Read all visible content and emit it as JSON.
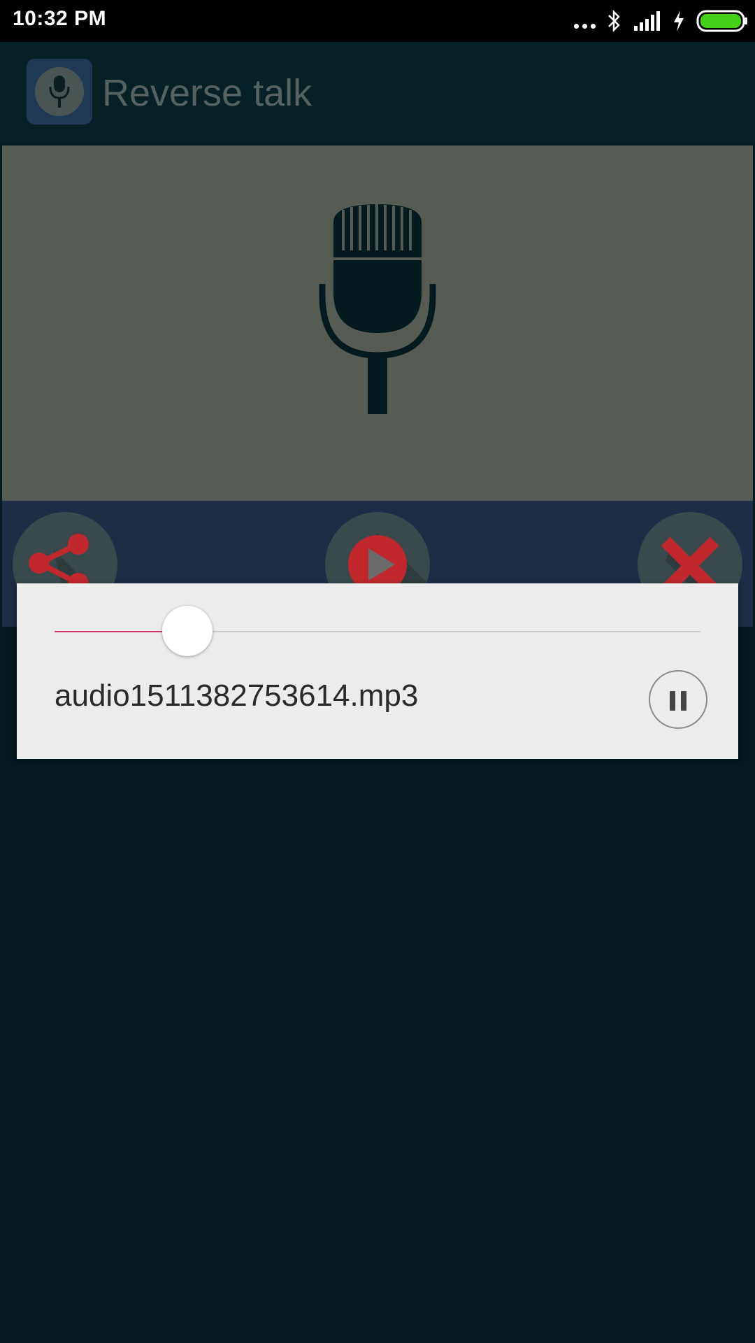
{
  "status_bar": {
    "time": "10:32 PM",
    "icons": [
      "more-dots-icon",
      "bluetooth-icon",
      "signal-icon",
      "charging-icon",
      "battery-icon"
    ],
    "battery_color": "#43d11a"
  },
  "app_bar": {
    "title": "Reverse talk",
    "logo_icon": "microphone-icon"
  },
  "main": {
    "mic_icon": "microphone-icon",
    "actions": [
      {
        "name": "share",
        "icon": "share-icon"
      },
      {
        "name": "play",
        "icon": "play-icon"
      },
      {
        "name": "delete",
        "icon": "close-icon"
      }
    ],
    "accent_color": "#c0282d"
  },
  "player_dialog": {
    "file_name": "audio1511382753614.mp3",
    "progress": 0.206,
    "progress_color": "#d6336c",
    "control_icon": "pause-icon"
  }
}
